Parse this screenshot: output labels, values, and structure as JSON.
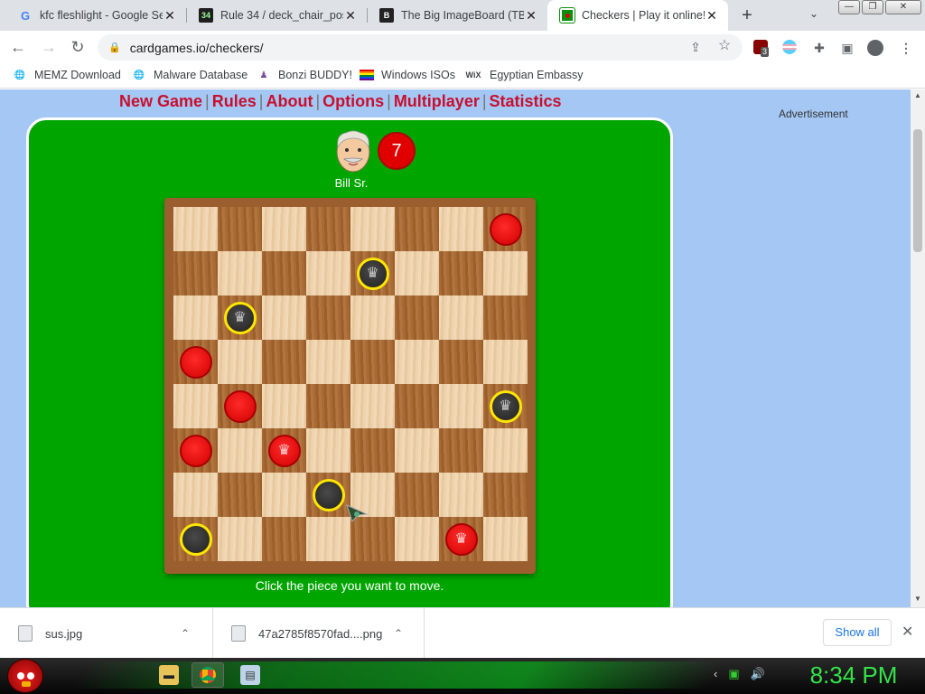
{
  "browser": {
    "tabs": [
      {
        "title": "kfc fleshlight - Google Se",
        "icon": "google-g-icon",
        "active": false
      },
      {
        "title": "Rule 34 / deck_chair_post",
        "icon": "r34-icon",
        "active": false
      },
      {
        "title": "The Big ImageBoard (TBIB",
        "icon": "tbib-icon",
        "active": false
      },
      {
        "title": "Checkers | Play it online!",
        "icon": "checkers-icon",
        "active": true
      }
    ],
    "new_tab": "+",
    "url": "cardgames.io/checkers/",
    "bookmarks": [
      {
        "label": "MEMZ Download",
        "icon": "globe-icon"
      },
      {
        "label": "Malware Database",
        "icon": "globe-icon"
      },
      {
        "label": "Bonzi BUDDY!",
        "icon": "bonzi-icon"
      },
      {
        "label": "Windows ISOs",
        "icon": "rainbow-flag-icon"
      },
      {
        "label": "Egyptian Embassy",
        "icon": "wix-icon"
      }
    ],
    "extension_badge": "3"
  },
  "site": {
    "nav": [
      "New Game",
      "Rules",
      "About",
      "Options",
      "Multiplayer",
      "Statistics"
    ],
    "nav_sep": "|",
    "ad_label": "Advertisement"
  },
  "game": {
    "opponent_name": "Bill Sr.",
    "opponent_score": "7",
    "status": "Click the piece you want to move.",
    "pieces": [
      {
        "row": 0,
        "col": 7,
        "color": "red",
        "king": false
      },
      {
        "row": 1,
        "col": 4,
        "color": "black",
        "king": true
      },
      {
        "row": 2,
        "col": 1,
        "color": "black",
        "king": true
      },
      {
        "row": 3,
        "col": 0,
        "color": "red",
        "king": false
      },
      {
        "row": 4,
        "col": 1,
        "color": "red",
        "king": false
      },
      {
        "row": 4,
        "col": 7,
        "color": "black",
        "king": true
      },
      {
        "row": 5,
        "col": 0,
        "color": "red",
        "king": false
      },
      {
        "row": 5,
        "col": 2,
        "color": "red",
        "king": true
      },
      {
        "row": 6,
        "col": 3,
        "color": "black",
        "king": false
      },
      {
        "row": 7,
        "col": 0,
        "color": "black",
        "king": false
      },
      {
        "row": 7,
        "col": 6,
        "color": "red",
        "king": true
      }
    ]
  },
  "downloads": {
    "items": [
      {
        "name": "sus.jpg"
      },
      {
        "name": "47a2785f8570fad....png"
      }
    ],
    "show_all": "Show all"
  },
  "taskbar": {
    "clock": "8:34 PM"
  }
}
